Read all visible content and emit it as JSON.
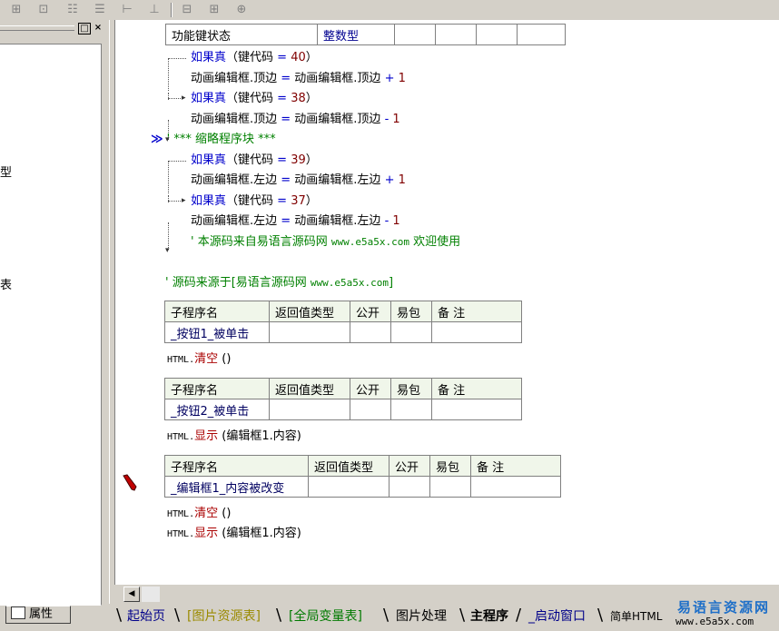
{
  "toolbar": {
    "icons": [
      "align-left-icon",
      "align-top-icon",
      "align-center-icon",
      "align-right-icon",
      "equal-width-icon",
      "equal-height-icon",
      "center-h-icon",
      "center-v-icon",
      "center-both-icon"
    ]
  },
  "left_panel": {
    "glyph1": "型",
    "glyph2": "表",
    "prop_tab_label": "属性",
    "close": "×",
    "min": "□"
  },
  "table_top": {
    "c1": "功能键状态",
    "c2": "整数型"
  },
  "code": {
    "l1": {
      "kw": "如果真",
      "a": "（键代码 ",
      "op": "=",
      "b": " ",
      "n": "40",
      "c": "）"
    },
    "l2": {
      "t": "动画编辑框.顶边 ",
      "op": "=",
      "t2": " 动画编辑框.顶边 ",
      "op2": "+",
      "n": " 1"
    },
    "l3": {
      "kw": "如果真",
      "a": "（键代码 ",
      "op": "=",
      "b": " ",
      "n": "38",
      "c": "）"
    },
    "l4": {
      "t": "动画编辑框.顶边 ",
      "op": "=",
      "t2": " 动画编辑框.顶边 ",
      "op2": "-",
      "n": " 1"
    },
    "l5": {
      "marker": "≫",
      "c": "' *** 缩略程序块 ***"
    },
    "l6": {
      "kw": "如果真",
      "a": "（键代码 ",
      "op": "=",
      "b": " ",
      "n": "39",
      "c": "）"
    },
    "l7": {
      "t": "动画编辑框.左边 ",
      "op": "=",
      "t2": " 动画编辑框.左边 ",
      "op2": "+",
      "n": " 1"
    },
    "l8": {
      "kw": "如果真",
      "a": "（键代码 ",
      "op": "=",
      "b": " ",
      "n": "37",
      "c": "）"
    },
    "l9": {
      "t": "动画编辑框.左边 ",
      "op": "=",
      "t2": " 动画编辑框.左边 ",
      "op2": "-",
      "n": " 1"
    },
    "l10": {
      "c1": "' 本源码来自易语言源码网 ",
      "url": "www.e5a5x.com",
      "c2": "  欢迎使用"
    },
    "l11": {
      "c1": "' 源码来源于[易语言源码网 ",
      "url": "www.e5a5x.com",
      "c2": "]"
    }
  },
  "sub_headers": [
    "子程序名",
    "返回值类型",
    "公开",
    "易包",
    "备 注"
  ],
  "subs": [
    {
      "name": "_按钮1_被单击",
      "code_obj": "HTML.",
      "code_fn": "清空",
      "code_args": " ()"
    },
    {
      "name": "_按钮2_被单击",
      "code_obj": "HTML.",
      "code_fn": "显示",
      "code_args": " (编辑框1.内容)"
    },
    {
      "name": "_编辑框1_内容被改变",
      "code_obj": "HTML.",
      "code_fn": "清空",
      "code_args": " ()",
      "code_obj2": "HTML.",
      "code_fn2": "显示",
      "code_args2": " (编辑框1.内容)"
    }
  ],
  "tabs": [
    "起始页",
    "[图片资源表]",
    "[全局变量表]",
    "图片处理",
    "主程序",
    "_启动窗口",
    "简单HTML"
  ],
  "watermark": {
    "line1": "易语言资源网",
    "line2": "www.e5a5x.com"
  },
  "colors": {
    "keyword": "#0000cc",
    "number": "#800000",
    "comment": "#008000",
    "function": "#aa0000",
    "tab_yellow": "#9a8a00",
    "tab_green": "#007a00",
    "tab_blue": "#00008a"
  }
}
